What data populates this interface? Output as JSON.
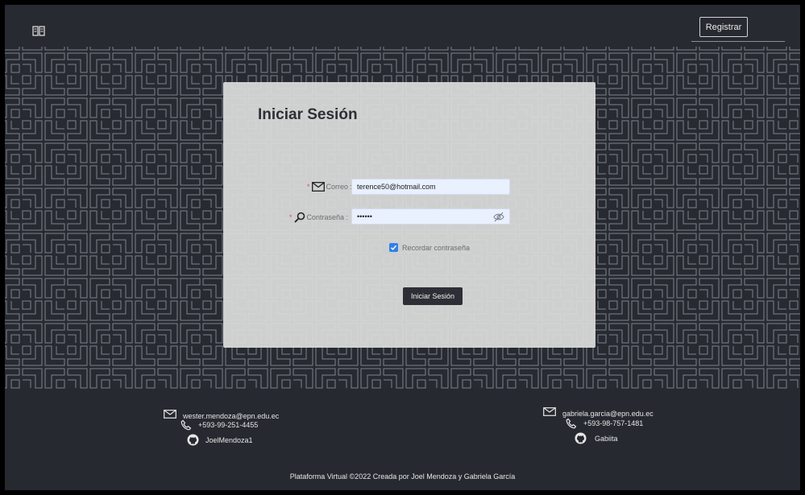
{
  "header": {
    "logo_icon": "book-open-icon",
    "register_label": "Registrar"
  },
  "login": {
    "title": "Iniciar Sesión",
    "email_label": "Correo",
    "email_value": "terence50@hotmail.com",
    "password_label": "Contraseña",
    "password_value": "••••••",
    "remember_label": "Recordar contraseña",
    "remember_checked": true,
    "submit_label": "Iniciar Sesión",
    "required_mark": "*",
    "label_suffix": ":"
  },
  "footer": {
    "contacts": [
      {
        "email": "wester.mendoza@epn.edu.ec",
        "phone": "+593-99-251-4455",
        "github": "JoelMendoza1"
      },
      {
        "email": "gabriela.garcia@epn.edu.ec",
        "phone": "+593-98-757-1481",
        "github": "Gabiita"
      }
    ],
    "copyright": "Plataforma Virtual ©2022 Creada por Joel Mendoza y Gabriela García"
  },
  "colors": {
    "background": "#272a30",
    "card": "#dcdcdc",
    "input_fill": "#e9f0fe",
    "accent": "#2f80ed",
    "button": "#2c2f35"
  }
}
